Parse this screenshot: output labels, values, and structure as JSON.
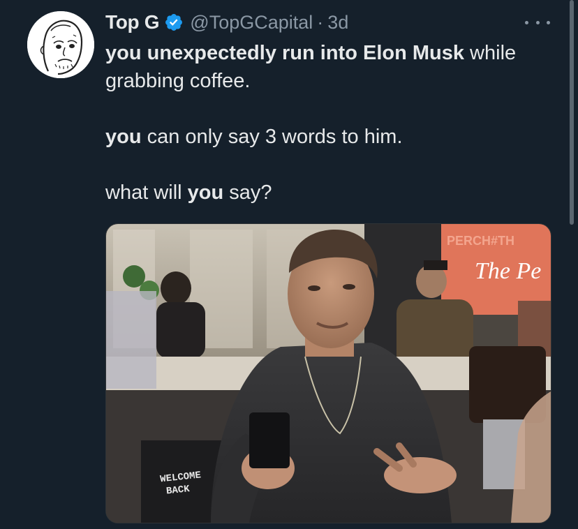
{
  "tweet": {
    "display_name": "Top G",
    "handle": "@TopGCapital",
    "separator": "·",
    "time": "3d",
    "more_icon": "more-horizontal-icon",
    "verified_icon": "verified-badge-icon",
    "colors": {
      "background": "#15202b",
      "text": "#e7e9ea",
      "muted": "#8b98a5",
      "verified": "#1d9bf0"
    },
    "text": {
      "line1_bold": "you unexpectedly run into Elon Musk",
      "line1_rest": " while grabbing coffee.",
      "line2_bold": "you",
      "line2_rest": " can only say 3 words to him.",
      "line3_start": "what will ",
      "line3_bold": "you",
      "line3_end": " say?"
    },
    "media": {
      "sign_lines": [
        "WELCOME",
        "BACK"
      ],
      "neon_text": "The Pe",
      "neon_bg_text": "PERCH#TH"
    }
  }
}
